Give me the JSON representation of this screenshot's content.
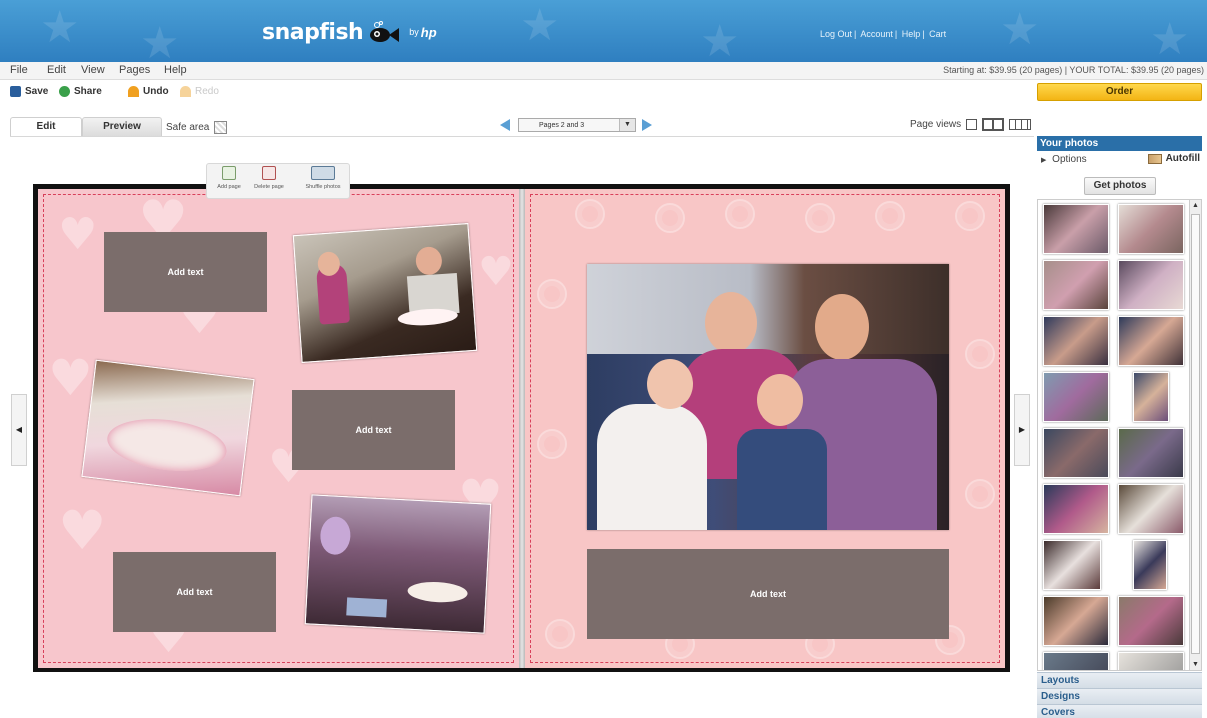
{
  "brand": {
    "name": "snapfish",
    "by": "by",
    "partner": "hp"
  },
  "top_links": [
    "Log Out",
    "Account",
    "Help",
    "Cart"
  ],
  "menu": [
    "File",
    "Edit",
    "View",
    "Pages",
    "Help"
  ],
  "pricing": "Starting at: $39.95 (20 pages)  |  YOUR TOTAL: $39.95 (20 pages)",
  "toolbar": {
    "save": "Save",
    "share": "Share",
    "undo": "Undo",
    "redo": "Redo",
    "order": "Order"
  },
  "tabs": {
    "edit": "Edit",
    "preview": "Preview",
    "safe_area": "Safe area"
  },
  "page_nav": {
    "current": "Pages 2 and 3"
  },
  "page_views_label": "Page views",
  "page_tools": {
    "add": "Add page",
    "delete": "Delete page",
    "shuffle": "Shuffle photos"
  },
  "text_boxes": {
    "label": "Add text"
  },
  "panel": {
    "title": "Your photos",
    "options": "Options",
    "autofill": "Autofill",
    "get_photos": "Get photos",
    "sections": [
      "Layouts",
      "Designs",
      "Covers"
    ]
  },
  "colors": {
    "header": "#2f7fc0",
    "accent_blue": "#2a6fa8",
    "order_button": "#f3b414",
    "page_left": "#f7c6cc",
    "page_right": "#f8c6c6",
    "text_box": "#7b6d6b",
    "safe_line": "#d8405a"
  }
}
